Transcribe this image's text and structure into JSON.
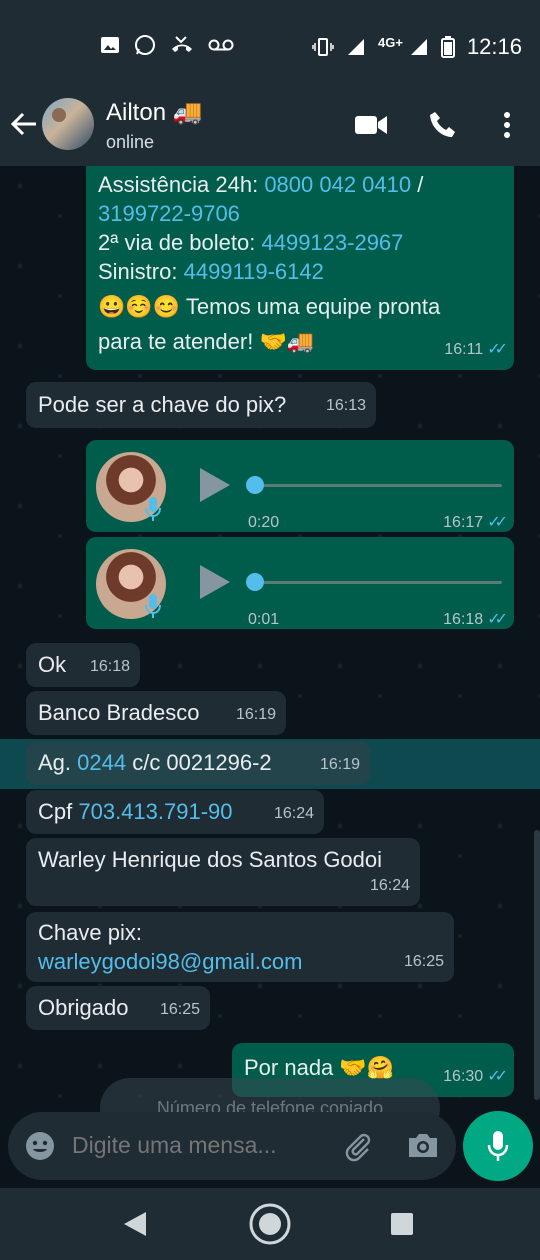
{
  "status_bar": {
    "time": "12:16",
    "network": "4G+"
  },
  "header": {
    "contact_name": "Ailton 🚚",
    "contact_status": "online"
  },
  "messages": {
    "m1": {
      "line1_text": "Assistência 24h: ",
      "line1_link": "0800 042 0410",
      "line1_sep": " /",
      "line2_link": "3199722-9706",
      "line3_text": "2ª via de boleto: ",
      "line3_link": "4499123-2967",
      "line4_text": "Sinistro: ",
      "line4_link": "4499119-6142",
      "line5_text": "😀☺️😊 Temos uma equipe pronta",
      "line6_text": "para te atender! 🤝🚚",
      "time": "16:11",
      "ticks": "✓✓"
    },
    "m2": {
      "text": "Pode ser a chave do pix?",
      "time": "16:13"
    },
    "audio1": {
      "duration": "0:20",
      "time": "16:17",
      "ticks": "✓✓",
      "progress": 0.0
    },
    "audio2": {
      "duration": "0:01",
      "time": "16:18",
      "ticks": "✓✓",
      "progress": 0.0
    },
    "m3": {
      "text": "Ok",
      "time": "16:18"
    },
    "m4": {
      "text": "Banco Bradesco",
      "time": "16:19"
    },
    "m5": {
      "text_a": "Ag. ",
      "link": "0244",
      "text_b": " c/c 0021296-2",
      "time": "16:19"
    },
    "m6": {
      "text_a": "Cpf ",
      "link": "703.413.791-90",
      "time": "16:24"
    },
    "m7": {
      "text": "Warley Henrique dos Santos Godoi",
      "time": "16:24"
    },
    "m8": {
      "text": "Chave pix:",
      "link": "warleygodoi98@gmail.com",
      "time": "16:25"
    },
    "m9": {
      "text": "Obrigado",
      "time": "16:25"
    },
    "m10": {
      "text": "Por nada 🤝🤗",
      "time": "16:30",
      "ticks": "✓✓"
    }
  },
  "toast": {
    "text": "Número de telefone copiado"
  },
  "input": {
    "placeholder": "Digite uma mensa..."
  },
  "colors": {
    "outgoing": "#005c4b",
    "incoming": "#202c33",
    "accent": "#00a884",
    "link": "#53bdeb"
  }
}
